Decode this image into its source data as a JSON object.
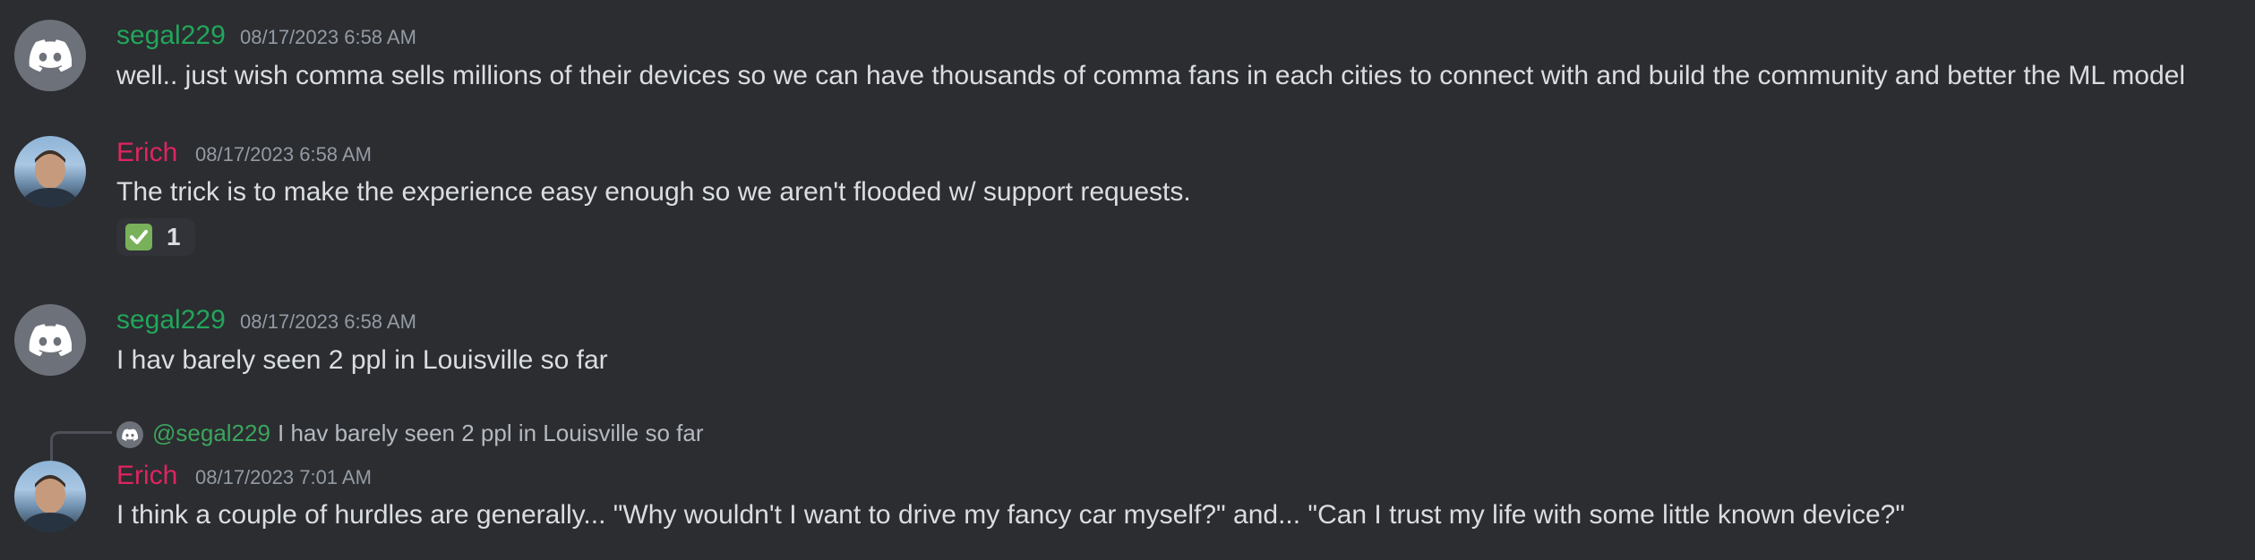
{
  "colors": {
    "background": "#2b2d31",
    "segal_name": "#23a55a",
    "erich_name": "#e0245e",
    "timestamp": "#949ba4",
    "mention": "#3ba55c",
    "reaction_bg": "#313338"
  },
  "messages": [
    {
      "author": "segal229",
      "timestamp": "08/17/2023 6:58 AM",
      "avatar": "discord-logo-icon",
      "text": "well.. just wish comma sells millions of their devices so we can have thousands of comma fans in each cities to connect with and build the community and better the ML model"
    },
    {
      "author": "Erich",
      "timestamp": "08/17/2023 6:58 AM",
      "avatar": "user-photo",
      "text": "The trick is to make the experience easy enough so we aren't flooded w/ support requests.",
      "reaction": {
        "emoji": "white-check-mark-icon",
        "count": "1"
      }
    },
    {
      "author": "segal229",
      "timestamp": "08/17/2023 6:58 AM",
      "avatar": "discord-logo-icon",
      "text": "I hav barely seen 2 ppl in Louisville so far"
    },
    {
      "author": "Erich",
      "timestamp": "08/17/2023 7:01 AM",
      "avatar": "user-photo",
      "reply": {
        "mention": "@segal229",
        "text": "I hav barely seen 2 ppl in Louisville so far"
      },
      "text": "I think a couple of hurdles are generally... \"Why wouldn't I want to drive my fancy car myself?\" and... \"Can I trust my life with some little known device?\""
    }
  ]
}
